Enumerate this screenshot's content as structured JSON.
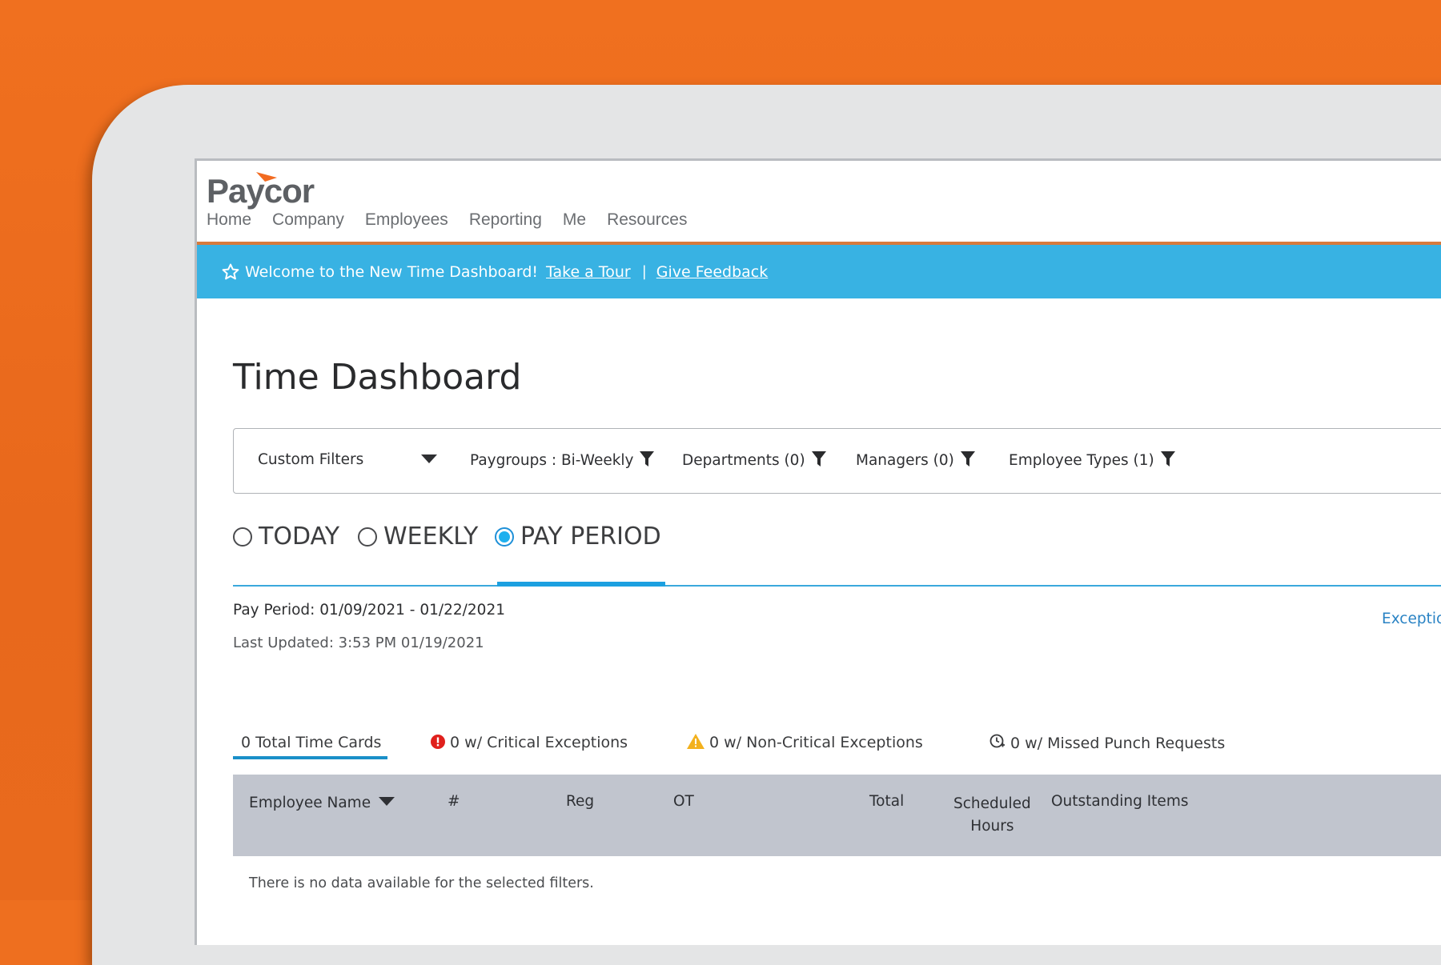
{
  "colors": {
    "brand_orange": "#ee6f1f",
    "banner_blue": "#38b2e3",
    "accent_blue": "#1ca0e0",
    "table_header": "#c1c5ce"
  },
  "brand": {
    "logo_text": "Paycor"
  },
  "nav": {
    "items": [
      "Home",
      "Company",
      "Employees",
      "Reporting",
      "Me",
      "Resources"
    ]
  },
  "banner": {
    "icon": "star-icon",
    "message": "Welcome to the New Time Dashboard!",
    "tour_link": "Take a Tour",
    "separator": "|",
    "feedback_link": "Give Feedback"
  },
  "page": {
    "title": "Time Dashboard"
  },
  "filters": {
    "custom_filters": "Custom Filters",
    "paygroups": "Paygroups : Bi-Weekly",
    "departments": "Departments (0)",
    "managers": "Managers (0)",
    "employee_types": "Employee Types (1)"
  },
  "period_options": {
    "today": "TODAY",
    "weekly": "WEEKLY",
    "pay_period": "PAY PERIOD",
    "selected": "PAY PERIOD"
  },
  "info": {
    "pay_period": "Pay Period: 01/09/2021 - 01/22/2021",
    "last_updated": "Last Updated: 3:53 PM 01/19/2021",
    "exceptions_link": "Exceptio"
  },
  "stats": {
    "total": "0 Total Time Cards",
    "critical": "0 w/ Critical Exceptions",
    "noncritical": "0 w/ Non-Critical Exceptions",
    "missed": "0 w/ Missed Punch Requests"
  },
  "table": {
    "headers": {
      "employee_name": "Employee Name",
      "number": "#",
      "reg": "Reg",
      "ot": "OT",
      "total": "Total",
      "scheduled_line1": "Scheduled",
      "scheduled_line2": "Hours",
      "outstanding": "Outstanding Items"
    },
    "empty_message": "There is no data available for the selected filters."
  }
}
